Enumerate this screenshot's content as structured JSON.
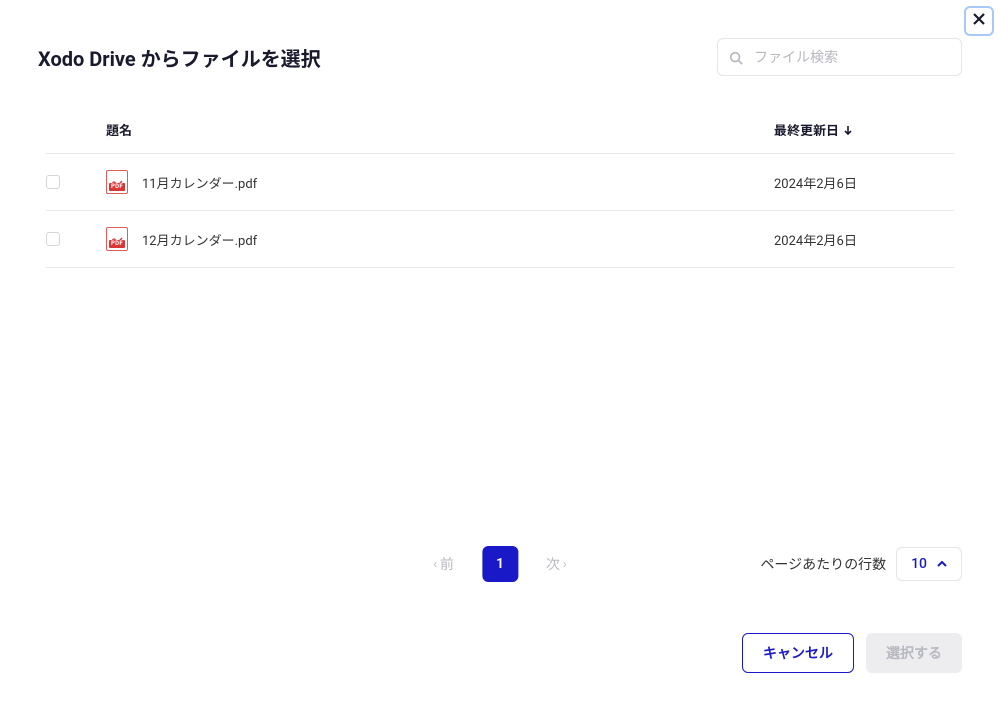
{
  "header": {
    "title": "Xodo Drive からファイルを選択",
    "search_placeholder": "ファイル検索"
  },
  "table": {
    "columns": {
      "title": "題名",
      "last_modified": "最終更新日"
    },
    "rows": [
      {
        "filename": "11月カレンダー.pdf",
        "last_modified": "2024年2月6日"
      },
      {
        "filename": "12月カレンダー.pdf",
        "last_modified": "2024年2月6日"
      }
    ]
  },
  "pagination": {
    "prev_label": "前",
    "next_label": "次",
    "current_page": "1",
    "rows_per_page_label": "ページあたりの行数",
    "rows_per_page_value": "10"
  },
  "actions": {
    "cancel": "キャンセル",
    "select": "選択する"
  }
}
